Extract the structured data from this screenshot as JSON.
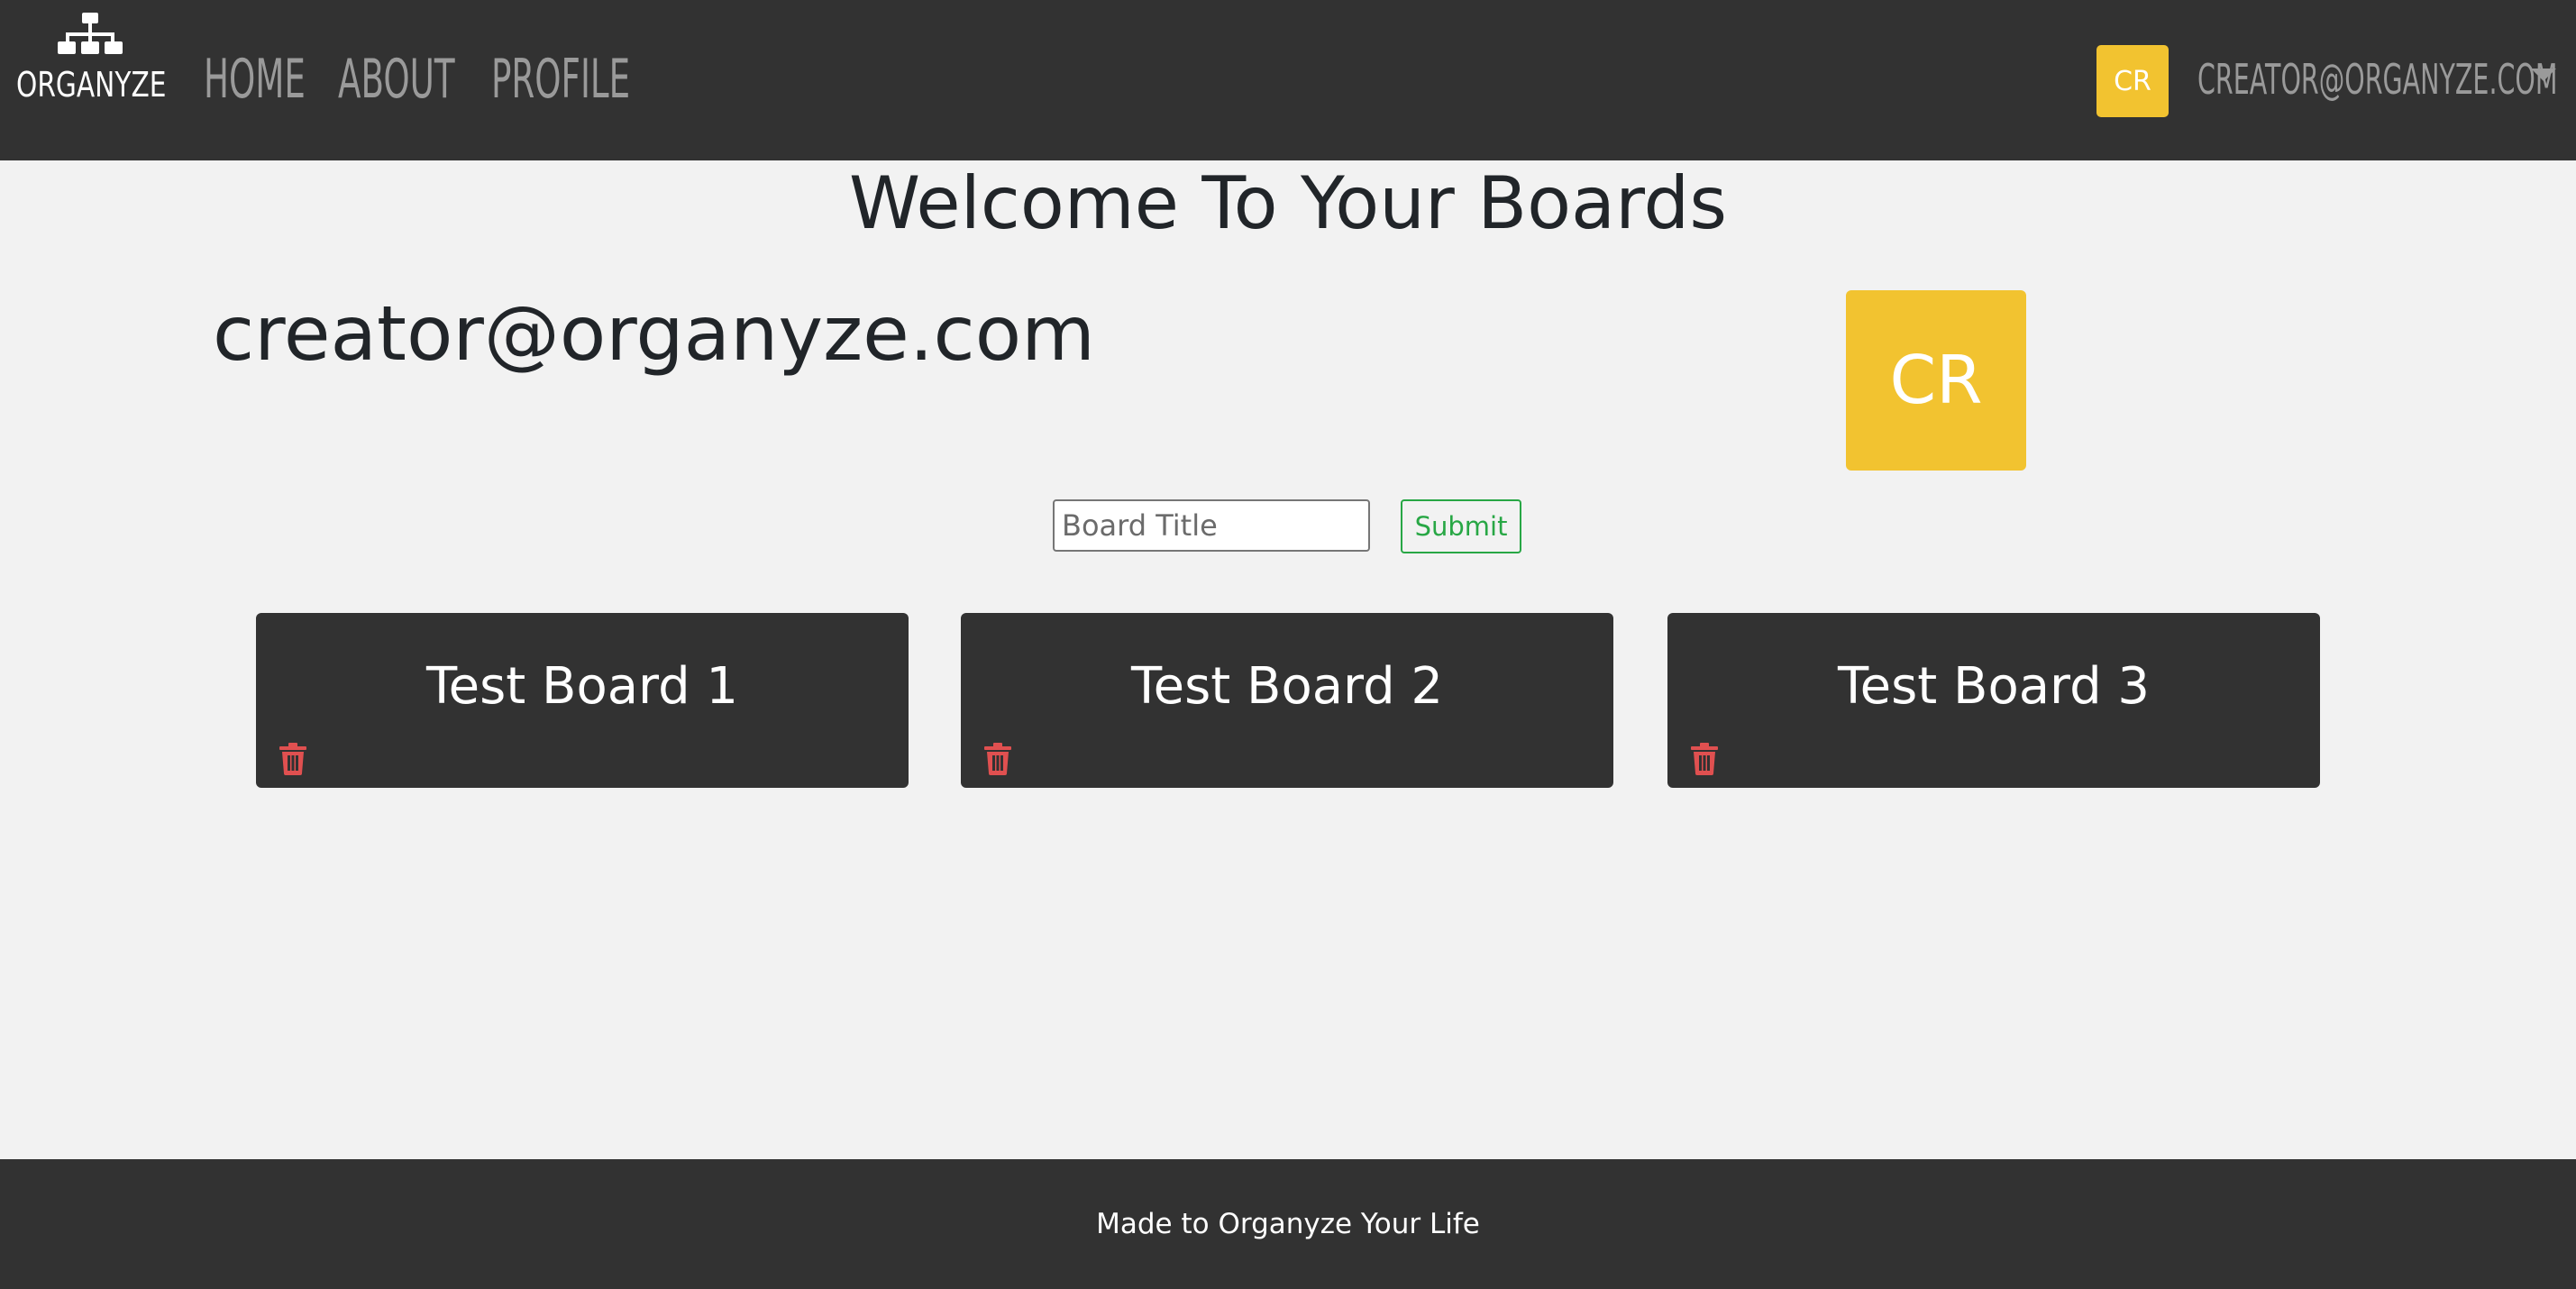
{
  "nav": {
    "brand": "ORGANYZE",
    "links": [
      "HOME",
      "ABOUT",
      "PROFILE"
    ],
    "avatar_initials": "CR",
    "user_email": "CREATOR@ORGANYZE.COM"
  },
  "main": {
    "welcome": "Welcome To Your Boards",
    "email": "creator@organyze.com",
    "avatar_initials": "CR",
    "form": {
      "placeholder": "Board Title",
      "value": "",
      "submit_label": "Submit"
    },
    "boards": [
      {
        "title": "Test Board 1"
      },
      {
        "title": "Test Board 2"
      },
      {
        "title": "Test Board 3"
      }
    ]
  },
  "footer": {
    "text": "Made to Organyze Your Life"
  },
  "colors": {
    "nav_bg": "#323232",
    "page_bg": "#f2f2f2",
    "avatar": "#f2c330",
    "submit": "#28a745",
    "trash": "#e05050"
  }
}
